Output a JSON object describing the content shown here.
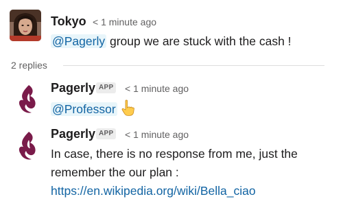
{
  "message1": {
    "author": "Tokyo",
    "time": "< 1 minute ago",
    "mention": "@Pagerly",
    "text": " group we are stuck with the cash !"
  },
  "thread": {
    "replies_label": "2 replies"
  },
  "reply1": {
    "author": "Pagerly",
    "badge": "APP",
    "time": "< 1 minute ago",
    "mention": "@Professor",
    "emoji": "point-up-emoji"
  },
  "reply2": {
    "author": "Pagerly",
    "badge": "APP",
    "time": "< 1 minute ago",
    "line1": "In case, there is no response from me, just the",
    "line2": "remember the our plan :",
    "link": "https://en.wikipedia.org/wiki/Bella_ciao"
  },
  "colors": {
    "link": "#1264a3",
    "mention_bg": "#e8f5fa",
    "pagerly_brand": "#7a1b4a"
  }
}
